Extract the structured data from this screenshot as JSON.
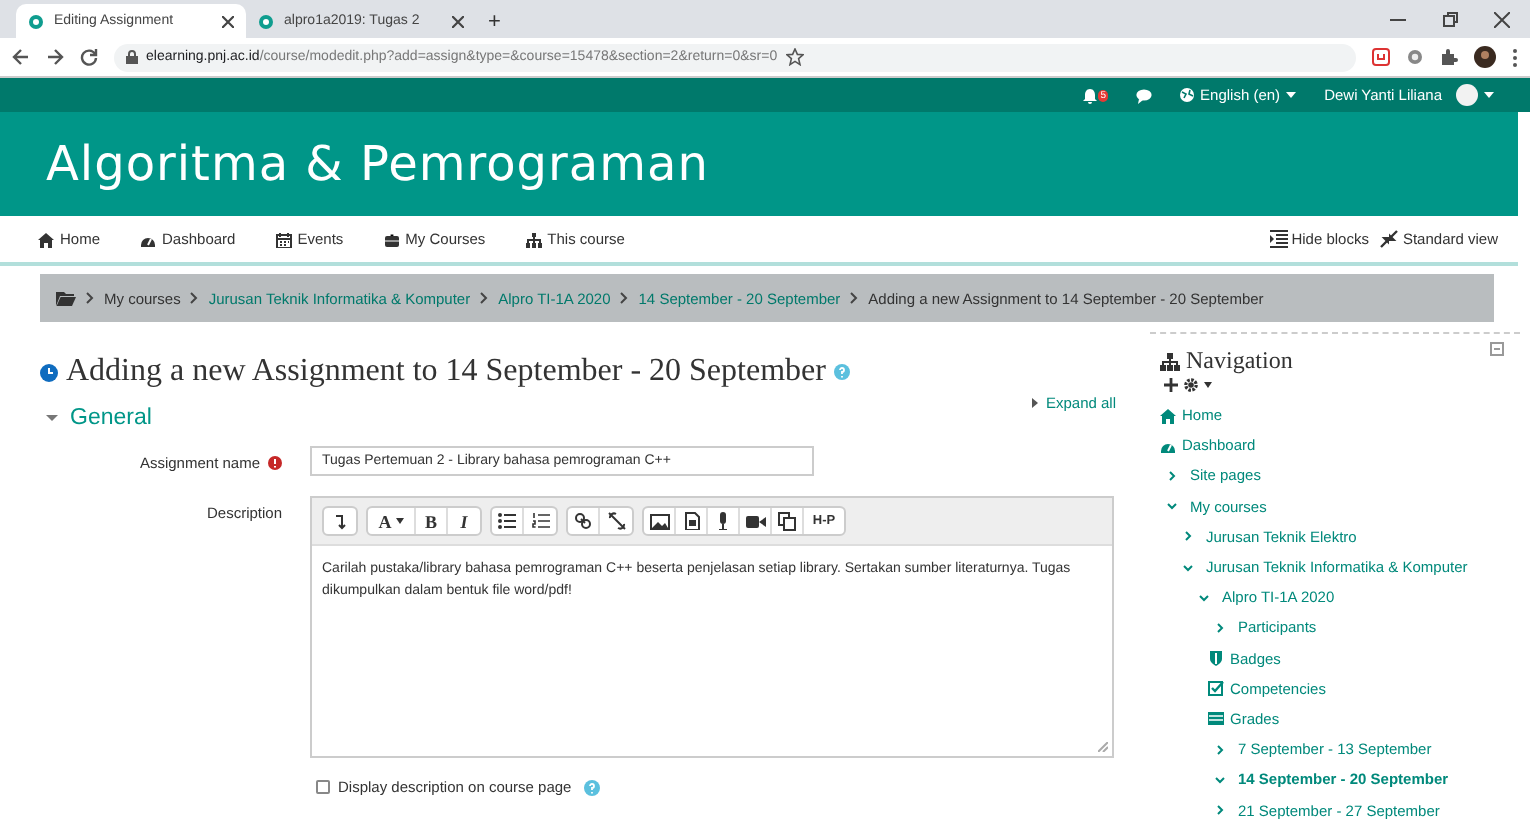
{
  "browser": {
    "tabs": [
      {
        "title": "Editing Assignment",
        "selected": true
      },
      {
        "title": "alpro1a2019: Tugas 2",
        "selected": false
      }
    ],
    "new_tab": "+",
    "url_host": "elearning.pnj.ac.id",
    "url_path": "/course/modedit.php?add=assign&type=&course=15478&section=2&return=0&sr=0"
  },
  "topbar": {
    "notifications": "5",
    "language": "English (en)",
    "user": "Dewi Yanti Liliana"
  },
  "site_title": "Algoritma & Pemrograman",
  "navbar": {
    "links": [
      "Home",
      "Dashboard",
      "Events",
      "My Courses",
      "This course"
    ],
    "actions": [
      "Hide blocks",
      "Standard view"
    ]
  },
  "breadcrumb": [
    {
      "label": "My courses",
      "link": false
    },
    {
      "label": "Jurusan Teknik Informatika & Komputer",
      "link": true
    },
    {
      "label": "Alpro TI-1A 2020",
      "link": true
    },
    {
      "label": "14 September - 20 September",
      "link": true
    },
    {
      "label": "Adding a new Assignment to 14 September - 20 September",
      "link": false
    }
  ],
  "page_heading": "Adding a new Assignment to 14 September - 20 September",
  "expand_all": "Expand all",
  "section": {
    "title": "General",
    "expanded": true
  },
  "fields": {
    "name_label": "Assignment name",
    "name_value": "Tugas Pertemuan 2 - Library bahasa pemrograman C++",
    "description_label": "Description",
    "description": "Carilah pustaka/library bahasa pemrograman C++ beserta penjelasan setiap library. Sertakan sumber literaturnya. Tugas dikumpulkan dalam bentuk file word/pdf!"
  },
  "toolbar": [
    [
      {
        "kind": "collapse"
      }
    ],
    [
      {
        "kind": "text",
        "label": "A"
      },
      {
        "kind": "text",
        "label": "B"
      },
      {
        "kind": "text",
        "label": "I"
      }
    ],
    [
      {
        "kind": "bullets"
      },
      {
        "kind": "numbers"
      }
    ],
    [
      {
        "kind": "link"
      },
      {
        "kind": "unlink"
      }
    ],
    [
      {
        "kind": "image"
      },
      {
        "kind": "media"
      },
      {
        "kind": "mic"
      },
      {
        "kind": "video"
      },
      {
        "kind": "copy"
      },
      {
        "kind": "text",
        "label": "H-P"
      }
    ]
  ],
  "display_on_course": {
    "label": "Display description on course page",
    "checked": false
  },
  "navigation": {
    "title": "Navigation",
    "items": [
      {
        "label": "Home",
        "kind": "home"
      },
      {
        "label": "Dashboard",
        "kind": "dashboard"
      },
      {
        "label": "Site pages",
        "kind": "branch",
        "expanded": false
      },
      {
        "label": "My courses",
        "kind": "branch",
        "expanded": true,
        "children": [
          {
            "label": "Jurusan Teknik Elektro",
            "kind": "branch",
            "expanded": false
          },
          {
            "label": "Jurusan Teknik Informatika & Komputer",
            "kind": "branch",
            "expanded": true,
            "children": [
              {
                "label": "Alpro TI-1A 2020",
                "kind": "branch",
                "expanded": true,
                "children": [
                  {
                    "label": "Participants",
                    "kind": "branch",
                    "expanded": false
                  },
                  {
                    "label": "Badges",
                    "kind": "badges"
                  },
                  {
                    "label": "Competencies",
                    "kind": "competencies"
                  },
                  {
                    "label": "Grades",
                    "kind": "grades"
                  },
                  {
                    "label": "7 September - 13 September",
                    "kind": "branch",
                    "expanded": false
                  },
                  {
                    "label": "14 September - 20 September",
                    "kind": "branch",
                    "expanded": true,
                    "current": true
                  },
                  {
                    "label": "21 September - 27 September",
                    "kind": "branch",
                    "expanded": false
                  }
                ]
              }
            ]
          }
        ]
      }
    ]
  }
}
